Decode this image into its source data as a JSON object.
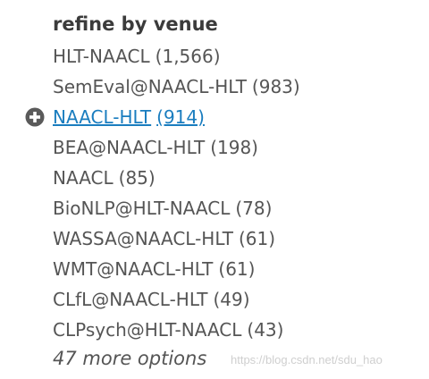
{
  "facet": {
    "heading": "refine by venue",
    "items": [
      {
        "label": "HLT-NAACL",
        "count": "(1,566)"
      },
      {
        "label": "SemEval@NAACL-HLT",
        "count": "(983)"
      },
      {
        "label": "NAACL-HLT",
        "count": "(914)"
      },
      {
        "label": "BEA@NAACL-HLT",
        "count": "(198)"
      },
      {
        "label": "NAACL",
        "count": "(85)"
      },
      {
        "label": "BioNLP@HLT-NAACL",
        "count": "(78)"
      },
      {
        "label": "WASSA@NAACL-HLT",
        "count": "(61)"
      },
      {
        "label": "WMT@NAACL-HLT",
        "count": "(61)"
      },
      {
        "label": "CLfL@NAACL-HLT",
        "count": "(49)"
      },
      {
        "label": "CLPsych@HLT-NAACL",
        "count": "(43)"
      }
    ],
    "hover_item_icon": "plus-circle-icon",
    "more_options": "47 more options"
  },
  "watermark": "https://blog.csdn.net/sdu_hao",
  "colors": {
    "text": "#555555",
    "heading": "#3b3b3b",
    "link": "#1a7dbf",
    "icon": "#5a5a5a",
    "watermark": "#cfcfcf"
  }
}
